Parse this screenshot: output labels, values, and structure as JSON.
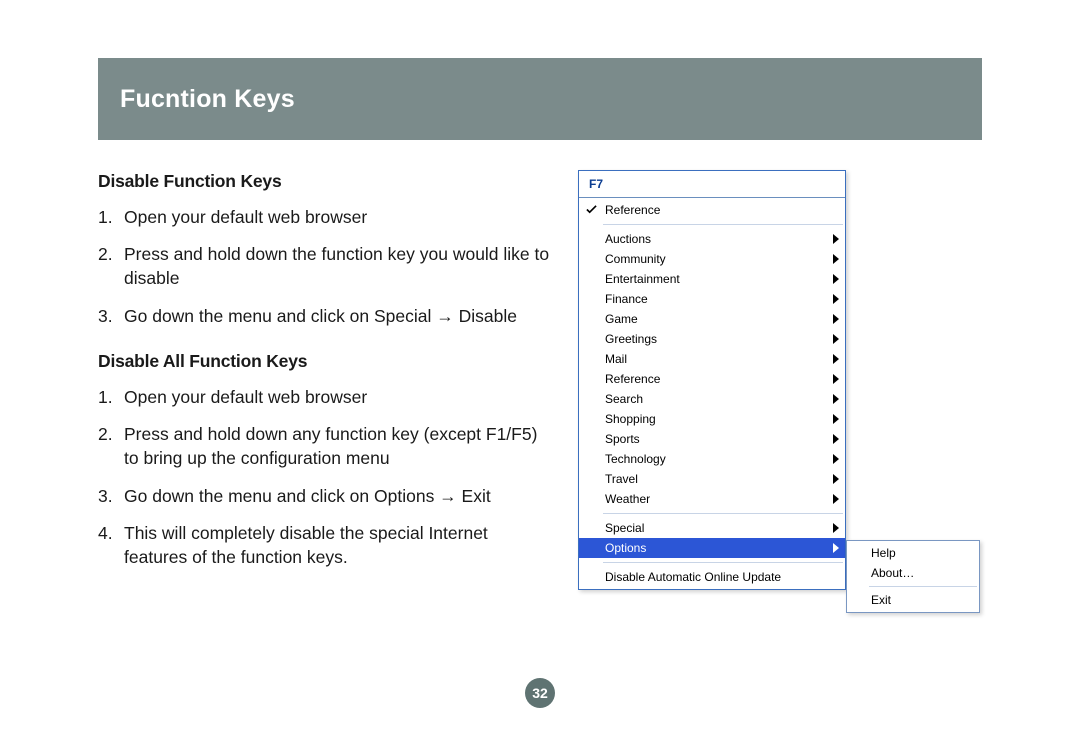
{
  "header": {
    "title": "Fucntion Keys"
  },
  "section1": {
    "heading": "Disable Function Keys",
    "steps": [
      "Open your default web browser",
      "Press and hold down the function key you would like to disable",
      "Go down the menu and click on Special → Disable"
    ]
  },
  "section2": {
    "heading": "Disable All Function Keys",
    "steps": [
      "Open your default web browser",
      "Press and hold down any function key (except F1/F5) to bring up the configuration menu",
      "Go down the menu and click on Options → Exit",
      "This will completely disable the special Internet features of the function keys."
    ]
  },
  "menu": {
    "title": "F7",
    "checked_item": "Reference",
    "items": [
      "Auctions",
      "Community",
      "Entertainment",
      "Finance",
      "Game",
      "Greetings",
      "Mail",
      "Reference",
      "Search",
      "Shopping",
      "Sports",
      "Technology",
      "Travel",
      "Weather"
    ],
    "special_label": "Special",
    "options_label": "Options",
    "disable_update_label": "Disable Automatic Online Update"
  },
  "submenu": {
    "help": "Help",
    "about": "About…",
    "exit": "Exit"
  },
  "page_number": "32"
}
